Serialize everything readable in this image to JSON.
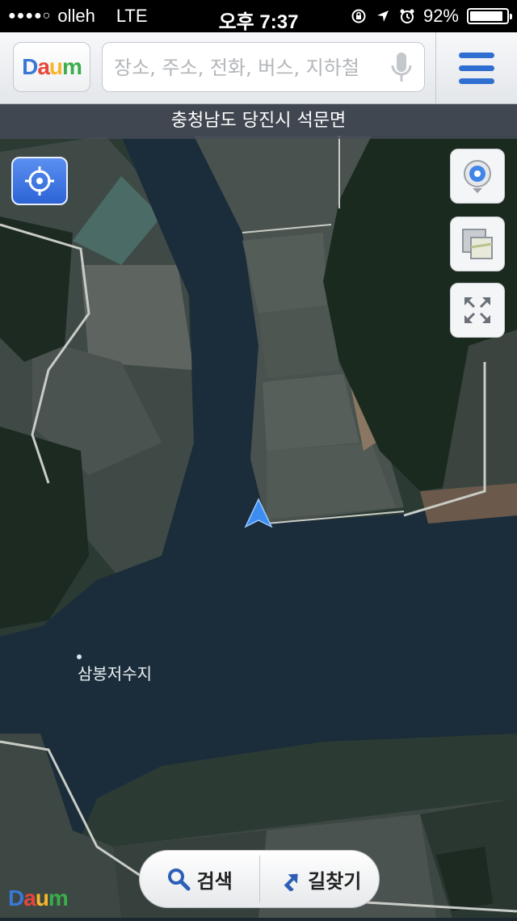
{
  "status": {
    "carrier": "olleh",
    "network": "LTE",
    "time": "오후 7:37",
    "battery": "92%",
    "battery_level": 0.92
  },
  "topbar": {
    "logo": "Daum",
    "search_placeholder": "장소, 주소, 전화, 버스, 지하철"
  },
  "location": "충청남도 당진시 석문면",
  "map": {
    "place_label": "삼봉저수지",
    "watermark": "Daum"
  },
  "bottom": {
    "search_label": "검색",
    "route_label": "길찾기"
  },
  "colors": {
    "accent": "#2f6fd1",
    "logo_d": "#3a78d6",
    "logo_a": "#e8453c",
    "logo_u": "#f7b52b",
    "logo_m": "#3aae4a"
  }
}
